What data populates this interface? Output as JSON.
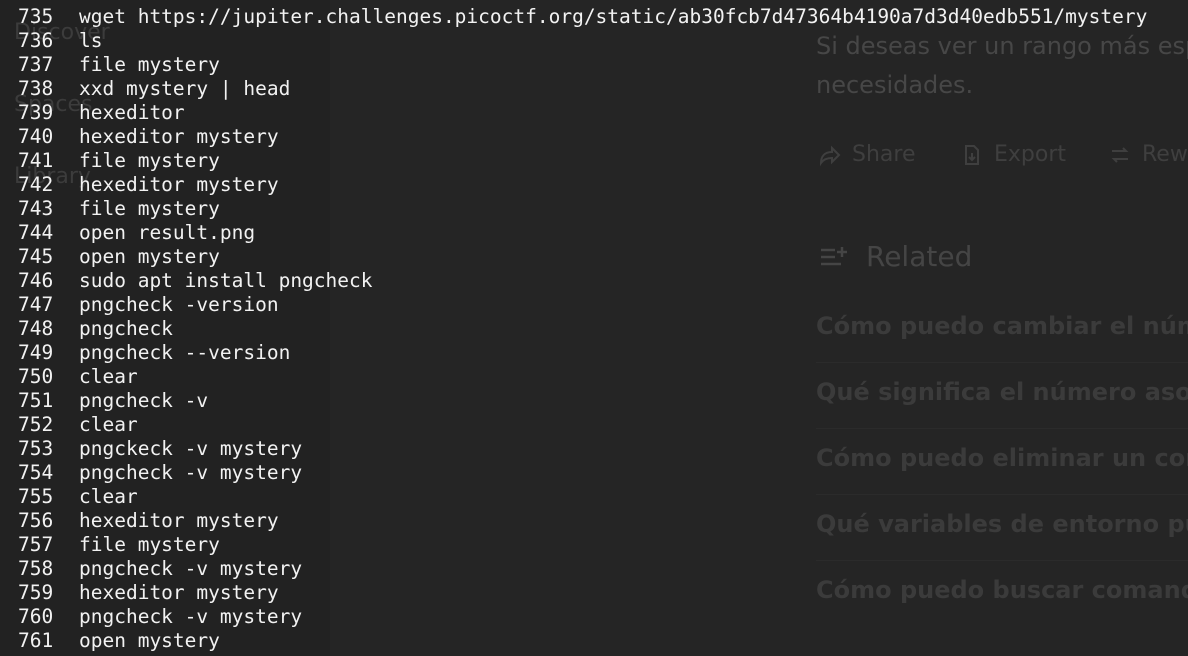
{
  "background_app": {
    "nav": [
      "Discover",
      "Spaces",
      "Library"
    ],
    "paragraph": [
      "",
      "Si deseas ver un rango más esp",
      "necesidades."
    ],
    "actions": {
      "share": "Share",
      "export": "Export",
      "rewrite": "Rew"
    },
    "related_title": "Related",
    "related_questions": [
      "Cómo puedo cambiar el núme",
      "Qué significa el número asocia",
      "Cómo puedo eliminar un coma",
      "Qué variables de entorno pue",
      "Cómo puedo buscar comando"
    ]
  },
  "terminal": {
    "history": [
      {
        "n": "735",
        "cmd": "wget https://jupiter.challenges.picoctf.org/static/ab30fcb7d47364b4190a7d3d40edb551/mystery"
      },
      {
        "n": "736",
        "cmd": "ls"
      },
      {
        "n": "737",
        "cmd": "file mystery"
      },
      {
        "n": "738",
        "cmd": "xxd mystery | head"
      },
      {
        "n": "739",
        "cmd": "hexeditor"
      },
      {
        "n": "740",
        "cmd": "hexeditor mystery"
      },
      {
        "n": "741",
        "cmd": "file mystery"
      },
      {
        "n": "742",
        "cmd": "hexeditor mystery"
      },
      {
        "n": "743",
        "cmd": "file mystery"
      },
      {
        "n": "744",
        "cmd": "open result.png"
      },
      {
        "n": "745",
        "cmd": "open mystery"
      },
      {
        "n": "746",
        "cmd": "sudo apt install pngcheck"
      },
      {
        "n": "747",
        "cmd": "pngcheck -version"
      },
      {
        "n": "748",
        "cmd": "pngcheck"
      },
      {
        "n": "749",
        "cmd": "pngcheck --version"
      },
      {
        "n": "750",
        "cmd": "clear"
      },
      {
        "n": "751",
        "cmd": "pngcheck -v"
      },
      {
        "n": "752",
        "cmd": "clear"
      },
      {
        "n": "753",
        "cmd": "pngckeck -v mystery"
      },
      {
        "n": "754",
        "cmd": "pngcheck -v mystery"
      },
      {
        "n": "755",
        "cmd": "clear"
      },
      {
        "n": "756",
        "cmd": "hexeditor mystery"
      },
      {
        "n": "757",
        "cmd": "file mystery"
      },
      {
        "n": "758",
        "cmd": "pngcheck -v mystery"
      },
      {
        "n": "759",
        "cmd": "hexeditor mystery"
      },
      {
        "n": "760",
        "cmd": "pngcheck -v mystery"
      },
      {
        "n": "761",
        "cmd": "open mystery"
      }
    ]
  },
  "colors": {
    "terminal_text": "#f2f2f2",
    "background": "#202020"
  }
}
